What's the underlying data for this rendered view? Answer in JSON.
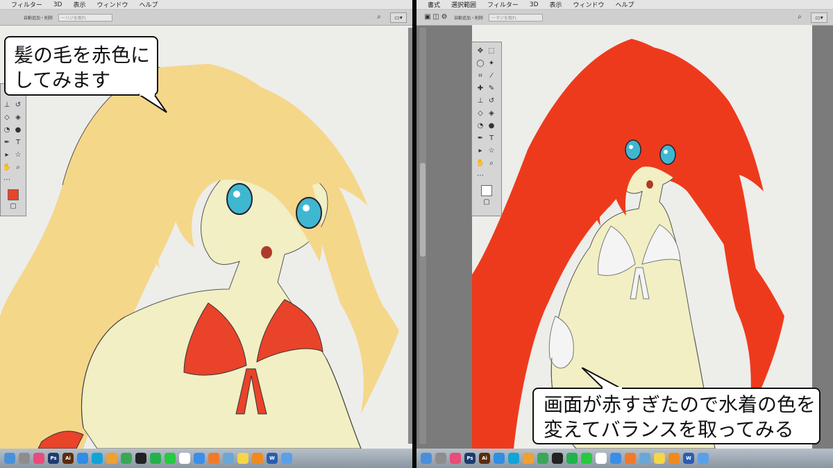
{
  "left": {
    "menu": [
      "フィルター",
      "3D",
      "表示",
      "ウィンドウ",
      "ヘルプ"
    ],
    "options": {
      "text": "自動追加・削除",
      "field": "ーリジを取れ"
    },
    "swatch_fg": "#e8452a",
    "swatch_bg": "#c9c0f0",
    "hair_color": "#f5d78a",
    "swimsuit_color": "#e9432a"
  },
  "right": {
    "menu": [
      "書式",
      "選択範囲",
      "フィルター",
      "3D",
      "表示",
      "ウィンドウ",
      "ヘルプ"
    ],
    "options": {
      "text": "自動追加・削除",
      "field": "ーマジを取れ"
    },
    "swatch_fg": "#ffffff",
    "swatch_bg": "#c9c0f0",
    "hair_color": "#ee3a1c",
    "swimsuit_color": "#f4f4f4"
  },
  "captions": {
    "left": [
      "髪の毛を赤色に",
      "してみます"
    ],
    "right": [
      "画面が赤すぎたので水着の色を",
      "変えてバランスを取ってみる"
    ]
  },
  "skin_color": "#f1efc3",
  "dock_apps": [
    "finder",
    "launchpad",
    "music",
    "photoshop",
    "illustrator",
    "safari",
    "skype",
    "photos",
    "chrome",
    "terminal",
    "line",
    "facetime",
    "calendar",
    "mail",
    "home",
    "preview",
    "notes",
    "vlc",
    "word",
    "finder-folder"
  ]
}
